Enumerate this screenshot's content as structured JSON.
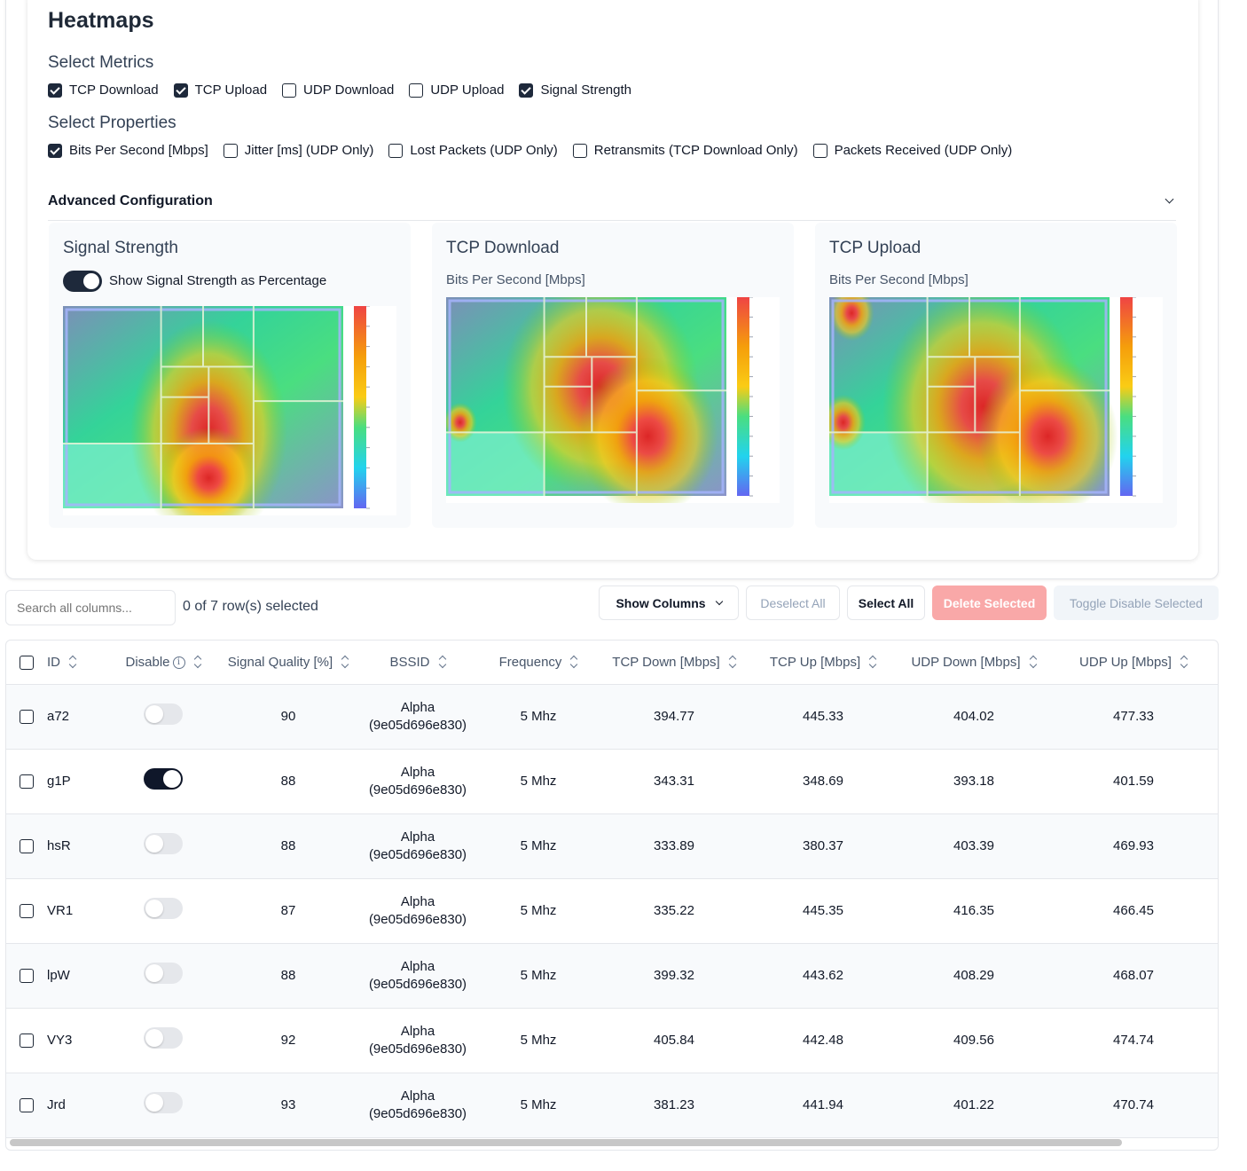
{
  "heatmaps": {
    "title": "Heatmaps",
    "select_metrics_title": "Select Metrics",
    "metrics": [
      {
        "label": "TCP Download",
        "checked": true
      },
      {
        "label": "TCP Upload",
        "checked": true
      },
      {
        "label": "UDP Download",
        "checked": false
      },
      {
        "label": "UDP Upload",
        "checked": false
      },
      {
        "label": "Signal Strength",
        "checked": true
      }
    ],
    "select_properties_title": "Select Properties",
    "properties": [
      {
        "label": "Bits Per Second [Mbps]",
        "checked": true
      },
      {
        "label": "Jitter [ms] (UDP Only)",
        "checked": false
      },
      {
        "label": "Lost Packets (UDP Only)",
        "checked": false
      },
      {
        "label": "Retransmits (TCP Download Only)",
        "checked": false
      },
      {
        "label": "Packets Received (UDP Only)",
        "checked": false
      }
    ],
    "advanced_label": "Advanced Configuration",
    "panels": [
      {
        "title": "Signal Strength",
        "toggle_label": "Show Signal Strength as Percentage"
      },
      {
        "title": "TCP Download",
        "subtitle": "Bits Per Second [Mbps]"
      },
      {
        "title": "TCP Upload",
        "subtitle": "Bits Per Second [Mbps]"
      }
    ]
  },
  "toolbar": {
    "search_placeholder": "Search all columns...",
    "selection": "0 of 7 row(s) selected",
    "show_columns": "Show Columns",
    "deselect_all": "Deselect All",
    "select_all": "Select All",
    "delete_selected": "Delete Selected",
    "toggle_disable_selected": "Toggle Disable Selected"
  },
  "table": {
    "headers": {
      "id": "ID",
      "disable": "Disable",
      "signal": "Signal Quality [%]",
      "bssid": "BSSID",
      "freq": "Frequency",
      "tcp_down": "TCP Down [Mbps]",
      "tcp_up": "TCP Up [Mbps]",
      "udp_down": "UDP Down [Mbps]",
      "udp_up": "UDP Up [Mbps]"
    },
    "rows": [
      {
        "id": "a72",
        "disabled": false,
        "signal": "90",
        "bssid_name": "Alpha",
        "bssid_mac": "(9e05d696e830)",
        "freq": "5 Mhz",
        "tcp_down": "394.77",
        "tcp_up": "445.33",
        "udp_down": "404.02",
        "udp_up": "477.33"
      },
      {
        "id": "g1P",
        "disabled": true,
        "signal": "88",
        "bssid_name": "Alpha",
        "bssid_mac": "(9e05d696e830)",
        "freq": "5 Mhz",
        "tcp_down": "343.31",
        "tcp_up": "348.69",
        "udp_down": "393.18",
        "udp_up": "401.59"
      },
      {
        "id": "hsR",
        "disabled": false,
        "signal": "88",
        "bssid_name": "Alpha",
        "bssid_mac": "(9e05d696e830)",
        "freq": "5 Mhz",
        "tcp_down": "333.89",
        "tcp_up": "380.37",
        "udp_down": "403.39",
        "udp_up": "469.93"
      },
      {
        "id": "VR1",
        "disabled": false,
        "signal": "87",
        "bssid_name": "Alpha",
        "bssid_mac": "(9e05d696e830)",
        "freq": "5 Mhz",
        "tcp_down": "335.22",
        "tcp_up": "445.35",
        "udp_down": "416.35",
        "udp_up": "466.45"
      },
      {
        "id": "lpW",
        "disabled": false,
        "signal": "88",
        "bssid_name": "Alpha",
        "bssid_mac": "(9e05d696e830)",
        "freq": "5 Mhz",
        "tcp_down": "399.32",
        "tcp_up": "443.62",
        "udp_down": "408.29",
        "udp_up": "468.07"
      },
      {
        "id": "VY3",
        "disabled": false,
        "signal": "92",
        "bssid_name": "Alpha",
        "bssid_mac": "(9e05d696e830)",
        "freq": "5 Mhz",
        "tcp_down": "405.84",
        "tcp_up": "442.48",
        "udp_down": "409.56",
        "udp_up": "474.74"
      },
      {
        "id": "Jrd",
        "disabled": false,
        "signal": "93",
        "bssid_name": "Alpha",
        "bssid_mac": "(9e05d696e830)",
        "freq": "5 Mhz",
        "tcp_down": "381.23",
        "tcp_up": "441.94",
        "udp_down": "401.22",
        "udp_up": "470.74"
      }
    ]
  }
}
